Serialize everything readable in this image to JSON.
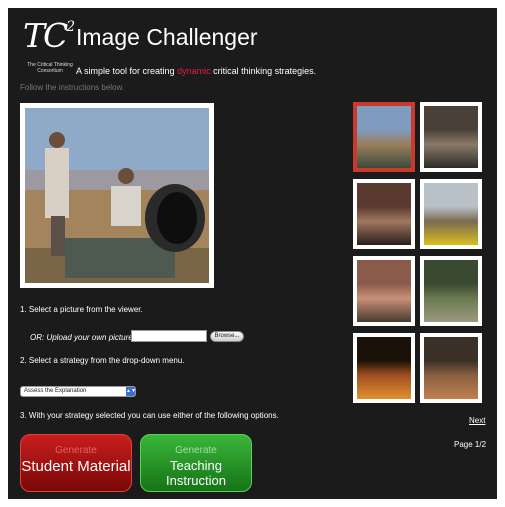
{
  "header": {
    "logo_mark": "TC",
    "logo_sup": "2",
    "logo_subtitle": "The Critical Thinking Consortium",
    "title": "Image Challenger",
    "tagline_before": "A simple tool for creating ",
    "tagline_highlight": "dynamic",
    "tagline_after": " critical thinking strategies.",
    "instructions": "Follow the instructions below."
  },
  "steps": {
    "step1": "1. Select a picture from the viewer.",
    "upload_label": "OR: Upload your own picture:",
    "upload_value": "",
    "browse_label": "Browse...",
    "step2": "2. Select a strategy from the drop-down menu.",
    "strategy_selected": "Assess the Explanation",
    "step3": "3. With your strategy selected you can use either of the following options."
  },
  "buttons": {
    "student_small": "Generate",
    "student_big": "Student Material",
    "teaching_small": "Generate",
    "teaching_big": "Teaching Instruction"
  },
  "viewer": {
    "thumbnails": [
      {
        "selected": true,
        "colors": [
          "#7f9cc0",
          "#9a7e5a",
          "#3d4a3e"
        ]
      },
      {
        "selected": false,
        "colors": [
          "#4a4038",
          "#8a7a6a",
          "#2e2a26"
        ]
      },
      {
        "selected": false,
        "colors": [
          "#5a3a2e",
          "#a07860",
          "#2a1e1a"
        ]
      },
      {
        "selected": false,
        "colors": [
          "#b8c0c8",
          "#7a6a50",
          "#d8c020"
        ]
      },
      {
        "selected": false,
        "colors": [
          "#8a5a4a",
          "#c89078",
          "#4a3a30"
        ]
      },
      {
        "selected": false,
        "colors": [
          "#3a4a30",
          "#6a7a50",
          "#9a9a80"
        ]
      },
      {
        "selected": false,
        "colors": [
          "#1a1208",
          "#a05020",
          "#e09030"
        ]
      },
      {
        "selected": false,
        "colors": [
          "#3a3028",
          "#8a6040",
          "#c08050"
        ]
      }
    ],
    "next_label": "Next",
    "page_label": "Page 1/2"
  },
  "colors": {
    "background": "#1b1b1b",
    "highlight": "#e0203a",
    "student_button": "#b01515",
    "teaching_button": "#2a9a2a",
    "selected_thumb_border": "#c93a2a"
  }
}
